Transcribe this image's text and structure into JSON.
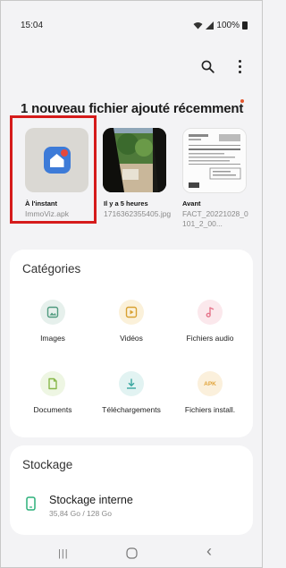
{
  "status": {
    "time": "15:04",
    "battery": "100%"
  },
  "recent": {
    "title": "1 nouveau fichier ajouté récemment",
    "items": [
      {
        "time": "À l'instant",
        "name": "ImmoViz.apk"
      },
      {
        "time": "Il y a 5 heures",
        "name": "1716362355405.jpg"
      },
      {
        "time": "Avant",
        "name": "FACT_20221028_0101_2_00..."
      }
    ]
  },
  "categories": {
    "title": "Catégories",
    "items": [
      {
        "label": "Images",
        "icon": "image-icon",
        "color": "#4f9a7e",
        "bg": "#e6f0ec"
      },
      {
        "label": "Vidéos",
        "icon": "video-icon",
        "color": "#d8a132",
        "bg": "#fbf1da"
      },
      {
        "label": "Fichiers audio",
        "icon": "music-note-icon",
        "color": "#e5758b",
        "bg": "#fbe8ec"
      },
      {
        "label": "Documents",
        "icon": "document-icon",
        "color": "#88b84a",
        "bg": "#eef6e3"
      },
      {
        "label": "Téléchargements",
        "icon": "download-icon",
        "color": "#39a6a0",
        "bg": "#e2f3f2"
      },
      {
        "label": "Fichiers install.",
        "icon": "apk-icon",
        "apk_text": "APK",
        "color": "#e0a33a",
        "bg": "#fbf0dc"
      }
    ]
  },
  "storage": {
    "title": "Stockage",
    "item": {
      "name": "Stockage interne",
      "size": "35,84 Go / 128 Go",
      "icon": "phone-icon",
      "color": "#2bb07a"
    }
  },
  "navbar": {
    "recents_glyph": "|||",
    "back_glyph": "‹"
  }
}
